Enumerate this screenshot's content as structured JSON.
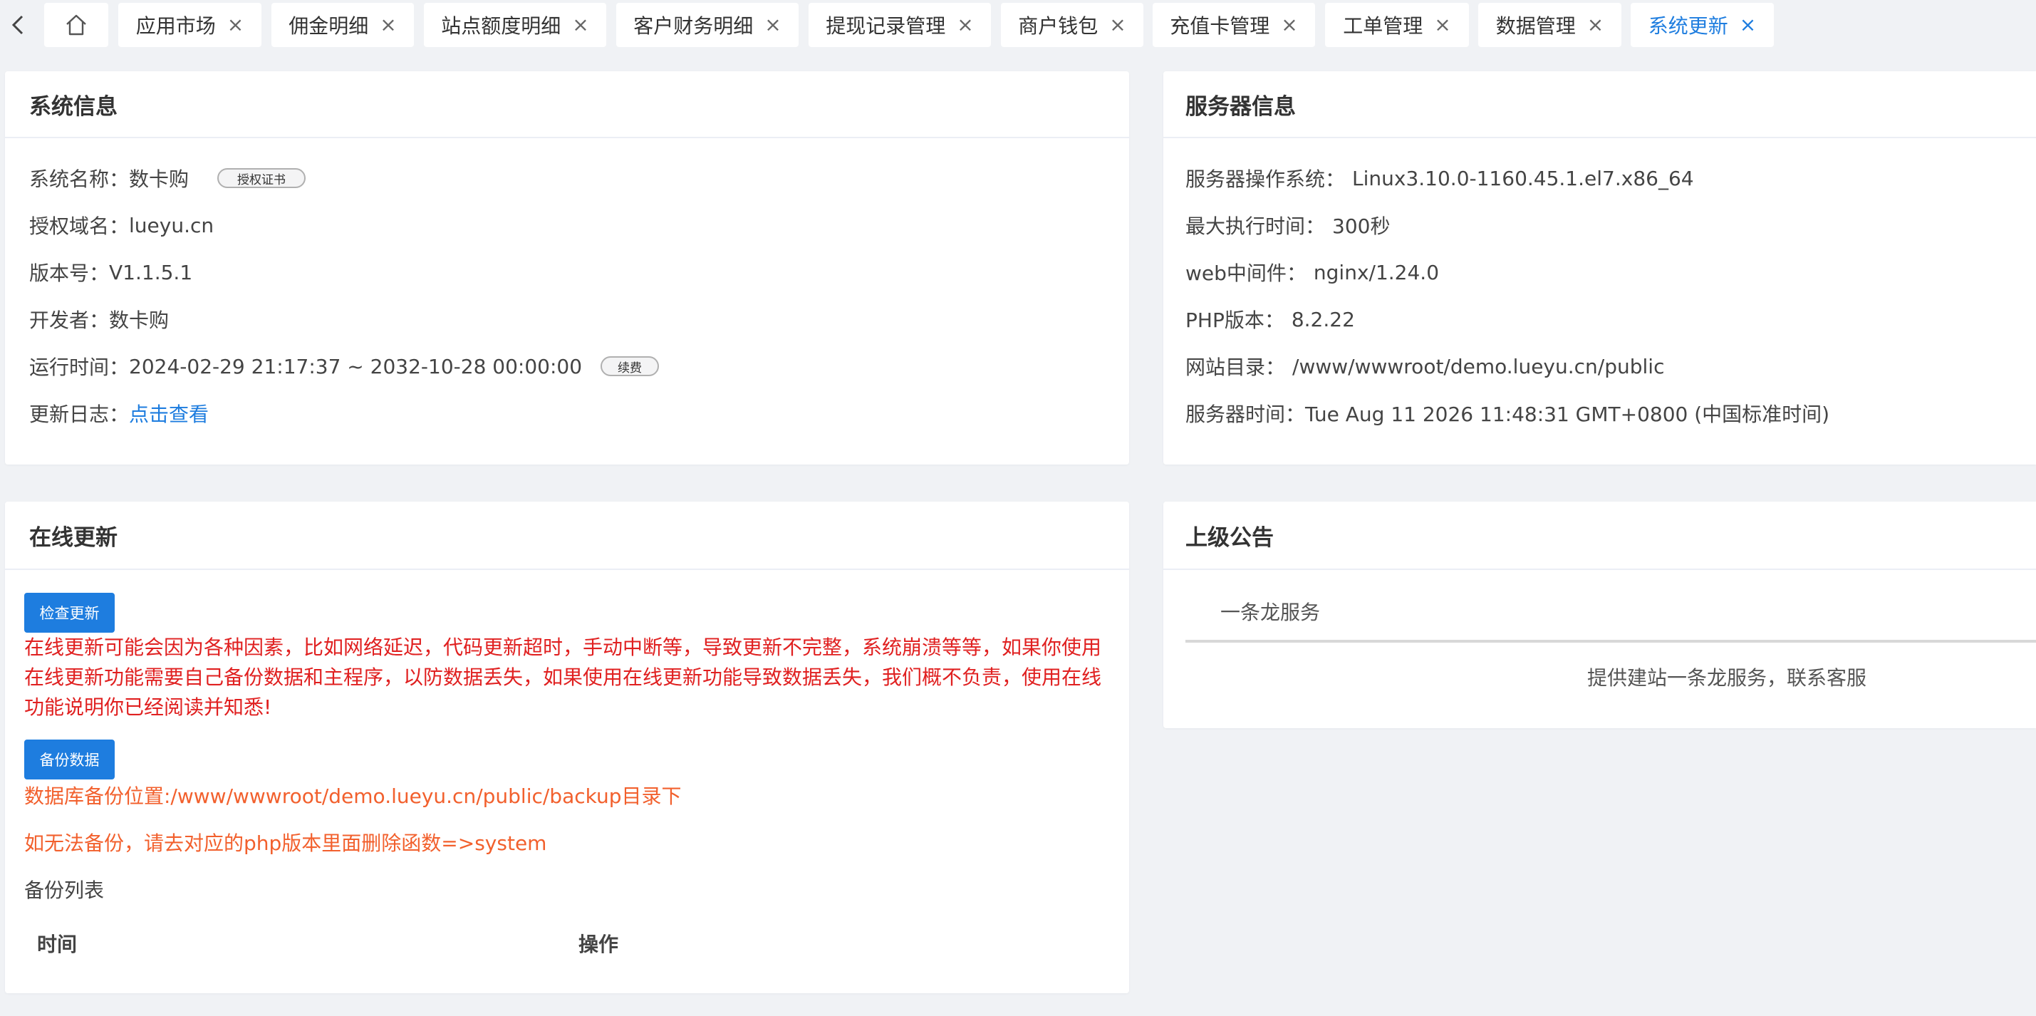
{
  "tabs": [
    {
      "label": "应用市场"
    },
    {
      "label": "佣金明细"
    },
    {
      "label": "站点额度明细"
    },
    {
      "label": "客户财务明细"
    },
    {
      "label": "提现记录管理"
    },
    {
      "label": "商户钱包"
    },
    {
      "label": "充值卡管理"
    },
    {
      "label": "工单管理"
    },
    {
      "label": "数据管理"
    },
    {
      "label": "系统更新"
    }
  ],
  "system_info": {
    "title": "系统信息",
    "name_label": "系统名称：",
    "name_value": "数卡购",
    "license_button": "授权证书",
    "domain_label": "授权域名：",
    "domain_value": "lueyu.cn",
    "version_label": "版本号：",
    "version_value": "V1.1.5.1",
    "developer_label": "开发者：",
    "developer_value": "数卡购",
    "runtime_label": "运行时间：",
    "runtime_value": "2024-02-29 21:17:37 ~ 2032-10-28 00:00:00",
    "renew_button": "续费",
    "changelog_label": "更新日志：",
    "changelog_link": "点击查看"
  },
  "server_info": {
    "title": "服务器信息",
    "os_label": "服务器操作系统：",
    "os_value": "Linux3.10.0-1160.45.1.el7.x86_64",
    "maxexec_label": "最大执行时间：",
    "maxexec_value": "300秒",
    "web_label": "web中间件：",
    "web_value": "nginx/1.24.0",
    "php_label": "PHP版本：",
    "php_value": "8.2.22",
    "dir_label": "网站目录：",
    "dir_value": "/www/wwwroot/demo.lueyu.cn/public",
    "time_label": "服务器时间：",
    "time_value": "Tue Aug 11 2026 11:48:31 GMT+0800 (中国标准时间)"
  },
  "online_update": {
    "title": "在线更新",
    "check_button": "检查更新",
    "warning": "在线更新可能会因为各种因素，比如网络延迟，代码更新超时，手动中断等，导致更新不完整，系统崩溃等等，如果你使用在线更新功能需要自己备份数据和主程序，以防数据丢失，如果使用在线更新功能导致数据丢失，我们概不负责，使用在线功能说明你已经阅读并知悉!",
    "backup_button": "备份数据",
    "backup_location": "数据库备份位置:/www/wwwroot/demo.lueyu.cn/public/backup目录下",
    "backup_hint": "如无法备份，请去对应的php版本里面删除函数=>system",
    "backup_list_label": "备份列表",
    "col_time": "时间",
    "col_action": "操作"
  },
  "notice": {
    "title": "上级公告",
    "tab_label": "一条龙服务",
    "content": "提供建站一条龙服务，联系客服"
  },
  "colors": {
    "accent": "#1e7ddf",
    "warning_red": "#e02020",
    "orange": "#f2602d",
    "background": "#f0f2f5"
  }
}
